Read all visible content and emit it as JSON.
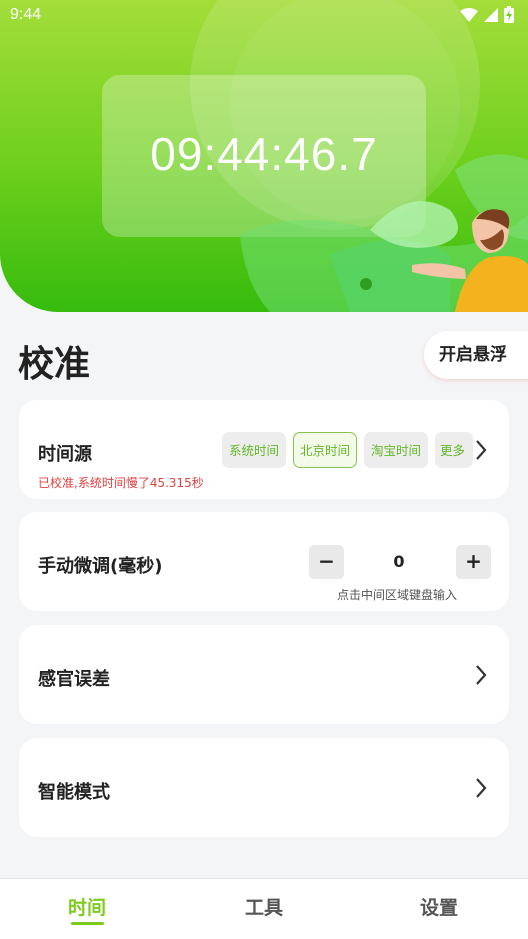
{
  "status_bar": {
    "time": "9:44"
  },
  "clock": {
    "display": "09:44:46.7"
  },
  "section": {
    "title": "校准",
    "float_button": "开启悬浮"
  },
  "time_source": {
    "label": "时间源",
    "status": "已校准,系统时间慢了45.315秒",
    "options": [
      "系统时间",
      "北京时间",
      "淘宝时间",
      "更多"
    ],
    "selected": "北京时间"
  },
  "manual_adjust": {
    "label": "手动微调(毫秒)",
    "minus": "−",
    "value": "0",
    "plus": "+",
    "hint": "点击中间区域键盘输入"
  },
  "sensory_error": {
    "label": "感官误差"
  },
  "smart_mode": {
    "label": "智能模式"
  },
  "bottom_nav": {
    "items": [
      {
        "label": "时间",
        "active": true
      },
      {
        "label": "工具",
        "active": false
      },
      {
        "label": "设置",
        "active": false
      }
    ]
  },
  "colors": {
    "accent": "#7ecb1e",
    "status_red": "#e04141",
    "header_top": "#a4dd3a",
    "header_bottom": "#36bb0e"
  }
}
